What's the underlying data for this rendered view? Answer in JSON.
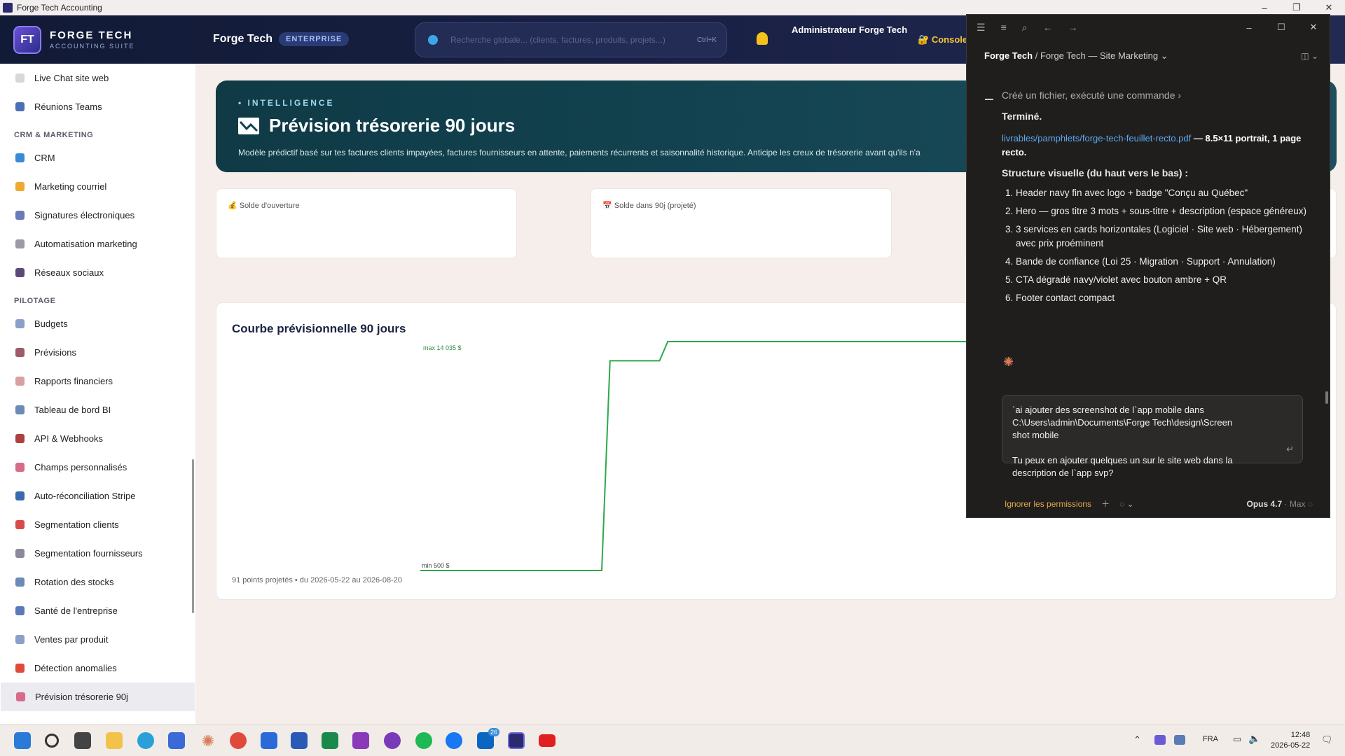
{
  "window": {
    "title": "Forge Tech Accounting"
  },
  "header": {
    "logo_line1": "FORGE TECH",
    "logo_line2": "ACCOUNTING SUITE",
    "logo_glyph": "FT",
    "company": "Forge Tech",
    "edition_badge": "ENTERPRISE",
    "search_placeholder": "Recherche globale... (clients, factures, produits, projets...)",
    "search_shortcut": "Ctrl+K",
    "admin_name": "Administrateur Forge Tech",
    "console_label": "Console"
  },
  "sidebar": {
    "items_top": [
      {
        "label": "Live Chat site web",
        "icon": "chat-bubble-icon",
        "color": "#d8d8d8"
      },
      {
        "label": "Réunions Teams",
        "icon": "calendar-icon",
        "color": "#4a6fb5"
      }
    ],
    "section_crm": "CRM & MARKETING",
    "items_crm": [
      {
        "label": "CRM",
        "icon": "heart-icon",
        "color": "#3a8bd6"
      },
      {
        "label": "Marketing courriel",
        "icon": "hand-icon",
        "color": "#f0a830"
      },
      {
        "label": "Signatures électroniques",
        "icon": "signature-icon",
        "color": "#6a7ab8"
      },
      {
        "label": "Automatisation marketing",
        "icon": "gear-icon",
        "color": "#9a9aa8"
      },
      {
        "label": "Réseaux sociaux",
        "icon": "phone-icon",
        "color": "#5a4a7a"
      }
    ],
    "section_pilotage": "PILOTAGE",
    "items_pilotage": [
      {
        "label": "Budgets",
        "icon": "chart-up-icon",
        "color": "#8aa0c8"
      },
      {
        "label": "Prévisions",
        "icon": "crystal-ball-icon",
        "color": "#a05a6a"
      },
      {
        "label": "Rapports financiers",
        "icon": "document-icon",
        "color": "#d8a0a0"
      },
      {
        "label": "Tableau de bord BI",
        "icon": "bar-chart-icon",
        "color": "#6a8ab8"
      },
      {
        "label": "API & Webhooks",
        "icon": "plug-icon",
        "color": "#b04040"
      },
      {
        "label": "Champs personnalisés",
        "icon": "palette-icon",
        "color": "#d86a8a"
      },
      {
        "label": "Auto-réconciliation Stripe",
        "icon": "card-icon",
        "color": "#3a6ab0"
      },
      {
        "label": "Segmentation clients",
        "icon": "target-icon",
        "color": "#d84a4a"
      },
      {
        "label": "Segmentation fournisseurs",
        "icon": "building-icon",
        "color": "#8a8a9a"
      },
      {
        "label": "Rotation des stocks",
        "icon": "bar-chart-icon",
        "color": "#6a8ab8"
      },
      {
        "label": "Santé de l'entreprise",
        "icon": "stethoscope-icon",
        "color": "#5a7ab8"
      },
      {
        "label": "Ventes par produit",
        "icon": "chart-up-icon",
        "color": "#8aa0c8"
      },
      {
        "label": "Détection anomalies",
        "icon": "siren-icon",
        "color": "#e04a3a"
      },
      {
        "label": "Prévision trésorerie 90j",
        "icon": "chart-down-icon",
        "color": "#d86a8a"
      }
    ]
  },
  "hero": {
    "kicker": "• INTELLIGENCE",
    "title": "Prévision trésorerie 90 jours",
    "description": "Modèle prédictif basé sur tes factures clients impayées, factures fournisseurs en attente, paiements récurrents et saisonnalité historique. Anticipe les creux de trésorerie avant qu'ils n'a"
  },
  "kpis": [
    {
      "label": "💰 Solde d'ouverture"
    },
    {
      "label": "📅 Solde dans 90j (projeté)"
    }
  ],
  "chart_card": {
    "title": "Courbe prévisionnelle 90 jours",
    "footer": "91 points projetés • du 2026-05-22 au 2026-08-20"
  },
  "chart_data": {
    "type": "line",
    "title": "Courbe prévisionnelle 90 jours",
    "series": [
      {
        "color": "#2ea84a",
        "x": [
          0,
          18,
          19,
          25,
          26,
          90
        ],
        "values": [
          500,
          500,
          12900,
          12900,
          14035,
          14035
        ]
      }
    ],
    "annotations": [
      "max 14 035 $",
      "min 500 $"
    ],
    "ylim": [
      500,
      14035
    ],
    "xlim": [
      0,
      90
    ]
  },
  "panel": {
    "top_icons": [
      "menu-icon",
      "list-icon",
      "search-icon",
      "back-arrow-icon",
      "forward-arrow-icon"
    ],
    "breadcrumb_project": "Forge Tech",
    "breadcrumb_sep": " / ",
    "breadcrumb_rest": "Forge Tech — Site Marketing ⌄",
    "step_text": "Créé un fichier, exécuté une commande ›",
    "done": "Terminé.",
    "file_link": "livrables/pamphlets/forge-tech-feuillet-recto.pdf",
    "file_desc_a": " — 8.5×11 ",
    "file_desc_b": "portrait, 1 page recto.",
    "structure_title": "Structure visuelle (du haut vers le bas) :",
    "steps": [
      "Header navy fin avec logo + badge \"Conçu au Québec\"",
      "Hero — gros titre 3 mots + sous-titre + description (espace généreux)",
      "3 services en cards horizontales (Logiciel · Site web · Hébergement) avec prix proéminent",
      "Bande de confiance (Loi 25 · Migration · Support · Annulation)",
      "CTA dégradé navy/violet avec bouton ambre + QR",
      "Footer contact compact"
    ],
    "compose_line1": "`ai ajouter des screenshot de l`app mobile dans",
    "compose_line2": "C:\\Users\\admin\\Documents\\Forge Tech\\design\\Screen",
    "compose_line3": "shot mobile",
    "compose_line4": "Tu peux en ajouter quelques un sur le site web dans la",
    "compose_line5": "description de l`app svp?",
    "perm_label": "Ignorer les permissions",
    "model": "Opus 4.7",
    "model_mode": " · Max"
  },
  "taskbar": {
    "lang": "FRA",
    "time": "12:48",
    "date": "2026-05-22",
    "linkedin_badge": "26"
  }
}
